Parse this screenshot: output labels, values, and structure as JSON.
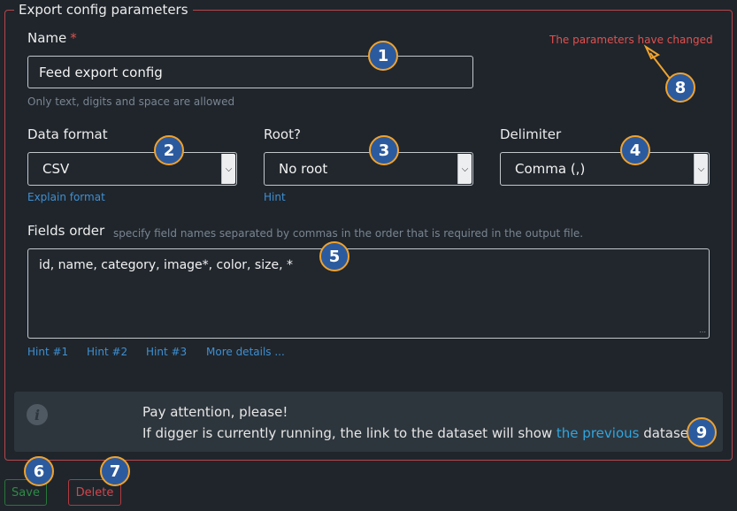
{
  "form": {
    "legend": "Export config parameters",
    "changed_notice": "The parameters have changed",
    "name": {
      "label": "Name",
      "required_mark": "*",
      "value": "Feed export config",
      "help": "Only text, digits and space are allowed"
    },
    "data_format": {
      "label": "Data format",
      "value": "CSV",
      "link": "Explain format"
    },
    "root": {
      "label": "Root?",
      "value": "No root",
      "link": "Hint"
    },
    "delimiter": {
      "label": "Delimiter",
      "value": "Comma (,)"
    },
    "fields_order": {
      "label": "Fields order",
      "help": "specify field names separated by commas in the order that is required in the output file.",
      "value": "id, name, category, image*, color, size, *",
      "hints": [
        "Hint #1",
        "Hint #2",
        "Hint #3",
        "More details ..."
      ]
    },
    "alert": {
      "title": "Pay attention, please!",
      "text_before": "If digger is currently running, the link to the dataset will show ",
      "link": "the previous",
      "text_after": " dataset."
    },
    "buttons": {
      "save": "Save",
      "delete": "Delete"
    }
  },
  "badges": [
    "1",
    "2",
    "3",
    "4",
    "5",
    "6",
    "7",
    "8",
    "9"
  ],
  "icons": {
    "info": "info-icon",
    "caret": "chevron-down-icon",
    "resize": "resize-grip-icon"
  },
  "colors": {
    "background": "#1f252b",
    "border_danger": "#b5474b",
    "link": "#3f8fd1",
    "badge_fill": "#2c5a9e",
    "badge_ring": "#f0a22d",
    "save": "#2e8b45",
    "delete": "#d0474d"
  }
}
